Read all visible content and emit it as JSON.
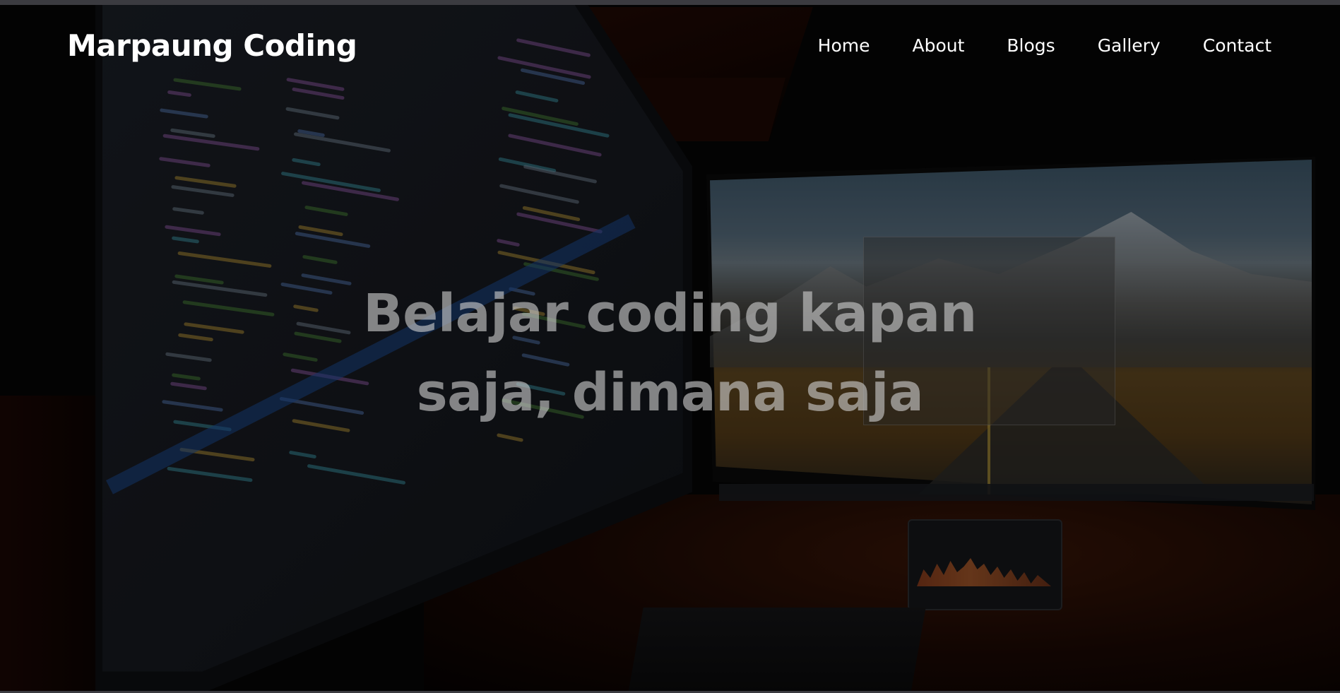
{
  "brand": {
    "name": "Marpaung Coding"
  },
  "nav": {
    "items": [
      "Home",
      "About",
      "Blogs",
      "Gallery",
      "Contact"
    ]
  },
  "hero": {
    "title_line1": "Belajar coding kapan",
    "title_line2": "saja, dimana saja"
  },
  "colors": {
    "text": "#ffffff",
    "hero_text": "#cdcdcd",
    "background": "#050505"
  }
}
